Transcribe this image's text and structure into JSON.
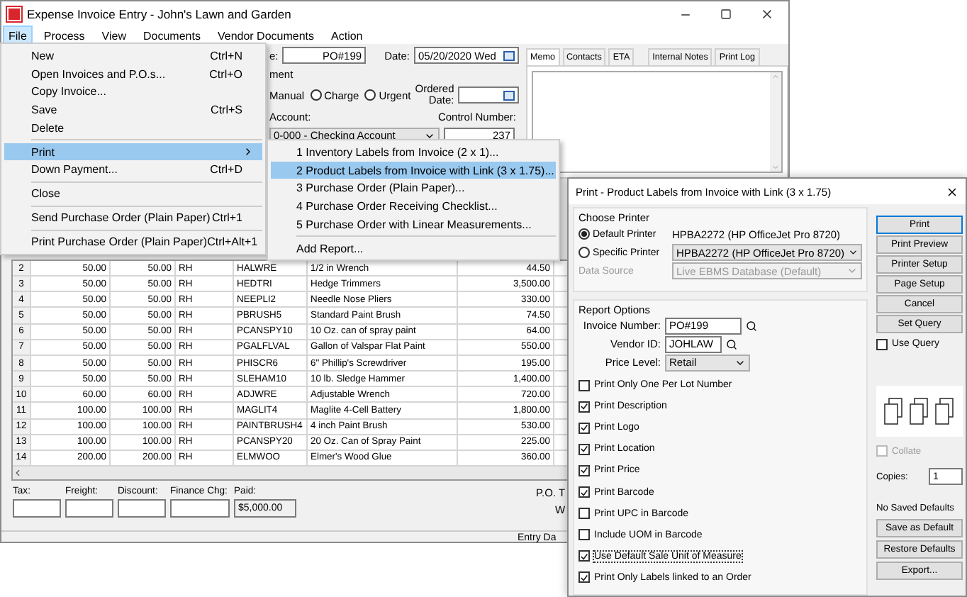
{
  "window": {
    "title": "Expense Invoice Entry - John's Lawn and Garden"
  },
  "menubar": [
    {
      "label": "File",
      "selected": true
    },
    {
      "label": "Process",
      "selected": false
    },
    {
      "label": "View",
      "selected": false
    },
    {
      "label": "Documents",
      "selected": false
    },
    {
      "label": "Vendor Documents",
      "selected": false
    },
    {
      "label": "Action",
      "selected": false
    }
  ],
  "header_form": {
    "po_label": "e:",
    "po_number": "PO#199",
    "date_label": "Date:",
    "date": "05/20/2020 Wed",
    "payment_label": "ment",
    "payment_options": [
      {
        "label": "Manual"
      },
      {
        "label": "Charge",
        "selected": false
      },
      {
        "label": "Urgent",
        "selected": false
      }
    ],
    "ordered_date_label": "Ordered Date:",
    "account_label": "Account:",
    "account": "0-000 - Checking Account",
    "control_number_label": "Control Number:",
    "control_number": "237"
  },
  "memo_tabs": [
    {
      "label": "Memo",
      "selected": true
    },
    {
      "label": "Contacts",
      "selected": false
    },
    {
      "label": "ETA",
      "selected": false
    },
    {
      "label": "Internal Notes",
      "selected": false
    },
    {
      "label": "Print Log",
      "selected": false
    }
  ],
  "grid_rows": [
    {
      "row": "2",
      "qty_1": "50.00",
      "qty_2": "50.00",
      "unit": "RH",
      "item": "HALWRE",
      "description": "1/2 in Wrench",
      "amount": "44.50"
    },
    {
      "row": "3",
      "qty_1": "50.00",
      "qty_2": "50.00",
      "unit": "RH",
      "item": "HEDTRI",
      "description": "Hedge Trimmers",
      "amount": "3,500.00"
    },
    {
      "row": "4",
      "qty_1": "50.00",
      "qty_2": "50.00",
      "unit": "RH",
      "item": "NEEPLI2",
      "description": "Needle Nose Pliers",
      "amount": "330.00"
    },
    {
      "row": "5",
      "qty_1": "50.00",
      "qty_2": "50.00",
      "unit": "RH",
      "item": "PBRUSH5",
      "description": "Standard Paint Brush",
      "amount": "74.50"
    },
    {
      "row": "6",
      "qty_1": "50.00",
      "qty_2": "50.00",
      "unit": "RH",
      "item": "PCANSPY10",
      "description": "10 Oz. can of spray paint",
      "amount": "64.00"
    },
    {
      "row": "7",
      "qty_1": "50.00",
      "qty_2": "50.00",
      "unit": "RH",
      "item": "PGALFLVAL",
      "description": "Gallon of Valspar Flat Paint",
      "amount": "550.00"
    },
    {
      "row": "8",
      "qty_1": "50.00",
      "qty_2": "50.00",
      "unit": "RH",
      "item": "PHISCR6",
      "description": "6\" Phillip's Screwdriver",
      "amount": "195.00"
    },
    {
      "row": "9",
      "qty_1": "50.00",
      "qty_2": "50.00",
      "unit": "RH",
      "item": "SLEHAM10",
      "description": "10 lb. Sledge Hammer",
      "amount": "1,400.00"
    },
    {
      "row": "10",
      "qty_1": "60.00",
      "qty_2": "60.00",
      "unit": "RH",
      "item": "ADJWRE",
      "description": "Adjustable Wrench",
      "amount": "720.00"
    },
    {
      "row": "11",
      "qty_1": "100.00",
      "qty_2": "100.00",
      "unit": "RH",
      "item": "MAGLIT4",
      "description": "Maglite 4-Cell Battery",
      "amount": "1,800.00"
    },
    {
      "row": "12",
      "qty_1": "100.00",
      "qty_2": "100.00",
      "unit": "RH",
      "item": "PAINTBRUSH4",
      "description": "4 inch Paint Brush",
      "amount": "530.00"
    },
    {
      "row": "13",
      "qty_1": "100.00",
      "qty_2": "100.00",
      "unit": "RH",
      "item": "PCANSPY20",
      "description": "20 Oz. Can of Spray Paint",
      "amount": "225.00"
    },
    {
      "row": "14",
      "qty_1": "200.00",
      "qty_2": "200.00",
      "unit": "RH",
      "item": "ELMWOO",
      "description": "Elmer's Wood Glue",
      "amount": "360.00"
    }
  ],
  "totals": {
    "fields": [
      {
        "label": "Tax:"
      },
      {
        "label": "Freight:"
      },
      {
        "label": "Discount:"
      },
      {
        "label": "Finance Chg:"
      }
    ],
    "paid_label": "Paid:",
    "paid": "$5,000.00",
    "right_texts": [
      "P.O. T",
      "W"
    ]
  },
  "status_bar": {
    "text": "Entry Da"
  },
  "file_menu": [
    {
      "kind": "item",
      "label": "New",
      "shortcut": "Ctrl+N",
      "selected": false
    },
    {
      "kind": "item",
      "label": "Open Invoices and P.O.s...",
      "shortcut": "Ctrl+O",
      "selected": false
    },
    {
      "kind": "item",
      "label": "Copy Invoice...",
      "selected": false
    },
    {
      "kind": "item",
      "label": "Save",
      "shortcut": "Ctrl+S",
      "selected": false
    },
    {
      "kind": "item",
      "label": "Delete",
      "selected": false
    },
    {
      "kind": "separator"
    },
    {
      "kind": "submenu",
      "label": "Print",
      "selected": true
    },
    {
      "kind": "item",
      "label": "Down Payment...",
      "shortcut": "Ctrl+D",
      "selected": false
    },
    {
      "kind": "separator"
    },
    {
      "kind": "item",
      "label": "Close",
      "selected": false
    },
    {
      "kind": "separator"
    },
    {
      "kind": "item",
      "label": "Send Purchase Order (Plain Paper)",
      "shortcut": "Ctrl+1",
      "selected": false
    },
    {
      "kind": "separator"
    },
    {
      "kind": "item",
      "label": "Print Purchase Order (Plain Paper)",
      "shortcut": "Ctrl+Alt+1",
      "selected": false
    }
  ],
  "print_submenu": [
    {
      "kind": "item",
      "label": "1 Inventory Labels from Invoice (2 x 1)...",
      "selected": false
    },
    {
      "kind": "item",
      "label": "2 Product Labels from Invoice with Link (3 x 1.75)...",
      "selected": true
    },
    {
      "kind": "item",
      "label": "3 Purchase Order (Plain Paper)...",
      "selected": false
    },
    {
      "kind": "item",
      "label": "4 Purchase Order Receiving Checklist...",
      "selected": false
    },
    {
      "kind": "item",
      "label": "5 Purchase Order with Linear Measurements...",
      "selected": false
    },
    {
      "kind": "separator"
    },
    {
      "kind": "item",
      "label": "Add Report...",
      "selected": false
    }
  ],
  "dialog": {
    "title": "Print - Product Labels from Invoice with Link (3 x 1.75)",
    "choose_printer": {
      "title": "Choose Printer",
      "default_printer": "HPBA2272 (HP OfficeJet Pro 8720)",
      "specific_printer": "HPBA2272 (HP OfficeJet Pro 8720)",
      "options": [
        {
          "label": "Default Printer",
          "selected": true
        },
        {
          "label": "Specific Printer",
          "selected": false
        }
      ],
      "data_source_label": "Data Source",
      "data_source": "Live EBMS Database (Default)",
      "data_source_disabled": true
    },
    "report_options": {
      "title": "Report Options",
      "invoice_number_label": "Invoice Number:",
      "invoice_number": "PO#199",
      "vendor_id_label": "Vendor ID:",
      "vendor_id": "JOHLAW",
      "price_level_label": "Price Level:",
      "price_level": "Retail",
      "checkboxes": [
        {
          "label": "Print Only One Per Lot Number",
          "checked": false,
          "focused": false
        },
        {
          "label": "Print Description",
          "checked": true,
          "focused": false
        },
        {
          "label": "Print Logo",
          "checked": true,
          "focused": false
        },
        {
          "label": "Print Location",
          "checked": true,
          "focused": false
        },
        {
          "label": "Print Price",
          "checked": true,
          "focused": false
        },
        {
          "label": "Print Barcode",
          "checked": true,
          "focused": false
        },
        {
          "label": "Print UPC in Barcode",
          "checked": false,
          "focused": false
        },
        {
          "label": "Include UOM in Barcode",
          "checked": false,
          "focused": false
        },
        {
          "label": "Use Default Sale Unit of Measure",
          "checked": true,
          "focused": true
        },
        {
          "label": "Print Only Labels linked to an Order",
          "checked": true,
          "focused": false
        }
      ]
    },
    "buttons": [
      {
        "label": "Print",
        "default": true
      },
      {
        "label": "Print Preview",
        "default": false
      },
      {
        "label": "Printer Setup",
        "default": false
      },
      {
        "label": "Page Setup",
        "default": false
      },
      {
        "label": "Cancel",
        "default": false
      },
      {
        "label": "Set Query",
        "default": false
      }
    ],
    "use_query": {
      "label": "Use Query",
      "checked": false
    },
    "collate": {
      "label": "Collate",
      "checked": false,
      "disabled": true
    },
    "copies_label": "Copies:",
    "copies": "1",
    "defaults_status": "No Saved Defaults",
    "defaults_buttons": [
      "Save as Default",
      "Restore Defaults",
      "Export..."
    ]
  }
}
